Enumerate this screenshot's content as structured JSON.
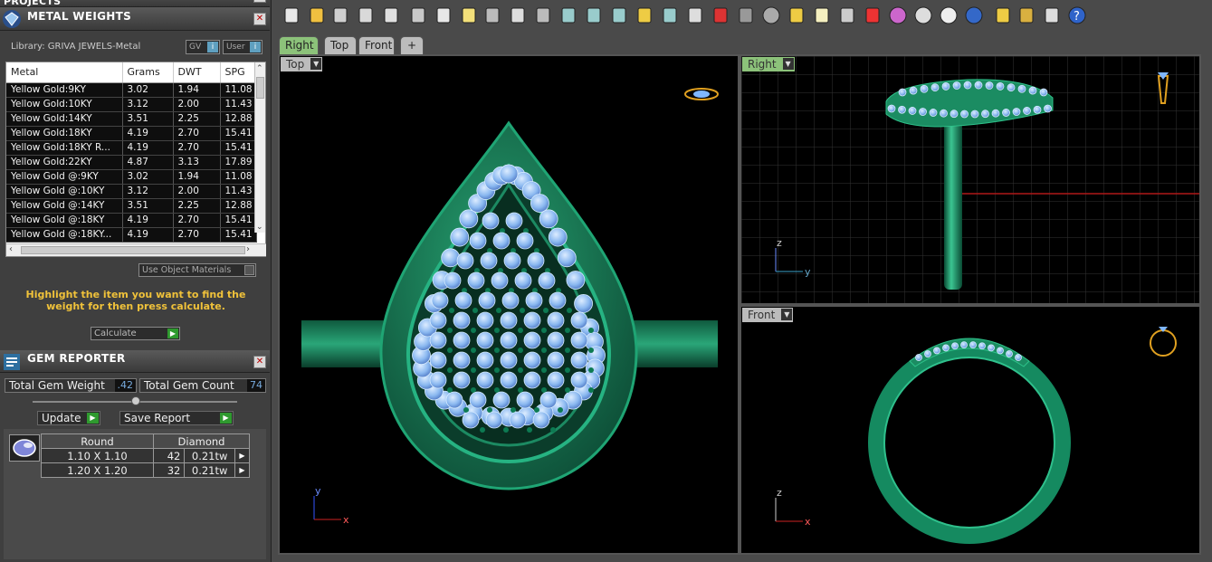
{
  "projects": {
    "title": "PROJECTS"
  },
  "metal_panel": {
    "title": "METAL WEIGHTS",
    "library": "Library: GRIVA JEWELS-Metal",
    "gv_label": "GV",
    "user_label": "User",
    "columns": [
      "Metal",
      "Grams",
      "DWT",
      "SPG"
    ],
    "rows": [
      [
        "Yellow Gold:9KY",
        "3.02",
        "1.94",
        "11.08"
      ],
      [
        "Yellow Gold:10KY",
        "3.12",
        "2.00",
        "11.43"
      ],
      [
        "Yellow Gold:14KY",
        "3.51",
        "2.25",
        "12.88"
      ],
      [
        "Yellow Gold:18KY",
        "4.19",
        "2.70",
        "15.41"
      ],
      [
        "Yellow Gold:18KY R...",
        "4.19",
        "2.70",
        "15.41"
      ],
      [
        "Yellow Gold:22KY",
        "4.87",
        "3.13",
        "17.89"
      ],
      [
        "Yellow Gold @:9KY",
        "3.02",
        "1.94",
        "11.08"
      ],
      [
        "Yellow Gold @:10KY",
        "3.12",
        "2.00",
        "11.43"
      ],
      [
        "Yellow Gold @:14KY",
        "3.51",
        "2.25",
        "12.88"
      ],
      [
        "Yellow Gold @:18KY",
        "4.19",
        "2.70",
        "15.41"
      ],
      [
        "Yellow Gold @:18KY...",
        "4.19",
        "2.70",
        "15.41"
      ]
    ],
    "use_object_materials": "Use Object Materials",
    "hint": "Highlight the item you want to find the weight for then press calculate.",
    "calculate": "Calculate"
  },
  "gem_panel": {
    "title": "GEM REPORTER",
    "total_weight_label": "Total Gem Weight",
    "total_weight_value": ".42",
    "total_count_label": "Total Gem Count",
    "total_count_value": "74",
    "update_label": "Update",
    "save_report_label": "Save Report",
    "header": [
      "Round",
      "Diamond"
    ],
    "rows": [
      [
        "1.10 X 1.10",
        "42",
        "0.21tw"
      ],
      [
        "1.20 X 1.20",
        "32",
        "0.21tw"
      ]
    ]
  },
  "tabs": [
    "Right",
    "Top",
    "Front",
    "+"
  ],
  "viewports": {
    "top": {
      "label": "Top",
      "axis_v": "y",
      "axis_h": "x"
    },
    "right": {
      "label": "Right",
      "axis_v": "z",
      "axis_h": "y"
    },
    "front": {
      "label": "Front",
      "axis_v": "z",
      "axis_h": "x"
    }
  },
  "toolbar_icons": [
    "new-file-icon",
    "open-folder-icon",
    "save-icon",
    "print-icon",
    "export-icon",
    "cut-icon",
    "copy-icon",
    "paste-icon",
    "undo-icon",
    "pan-hand-icon",
    "move-icon",
    "zoom-in-icon",
    "zoom-window-icon",
    "zoom-extents-icon",
    "zoom-selected-icon",
    "rotate-view-icon",
    "four-viewports-icon",
    "car-icon",
    "hidden-icon",
    "circle-target-icon",
    "snap-icon",
    "lightbulb-icon",
    "lock-icon",
    "layer-icon",
    "color-wheel-icon",
    "shaded-sphere-icon",
    "rendered-sphere-icon",
    "blue-sphere-icon",
    "pen-icon",
    "settings-gear-icon",
    "dimension-icon",
    "help-icon"
  ],
  "colors": {
    "ring_green": "#1f8c64",
    "gem_blue": "#8ab8f0",
    "active_tab": "#8cc27a",
    "panel": "#3f3f3f",
    "hint_text": "#f0c23a"
  }
}
